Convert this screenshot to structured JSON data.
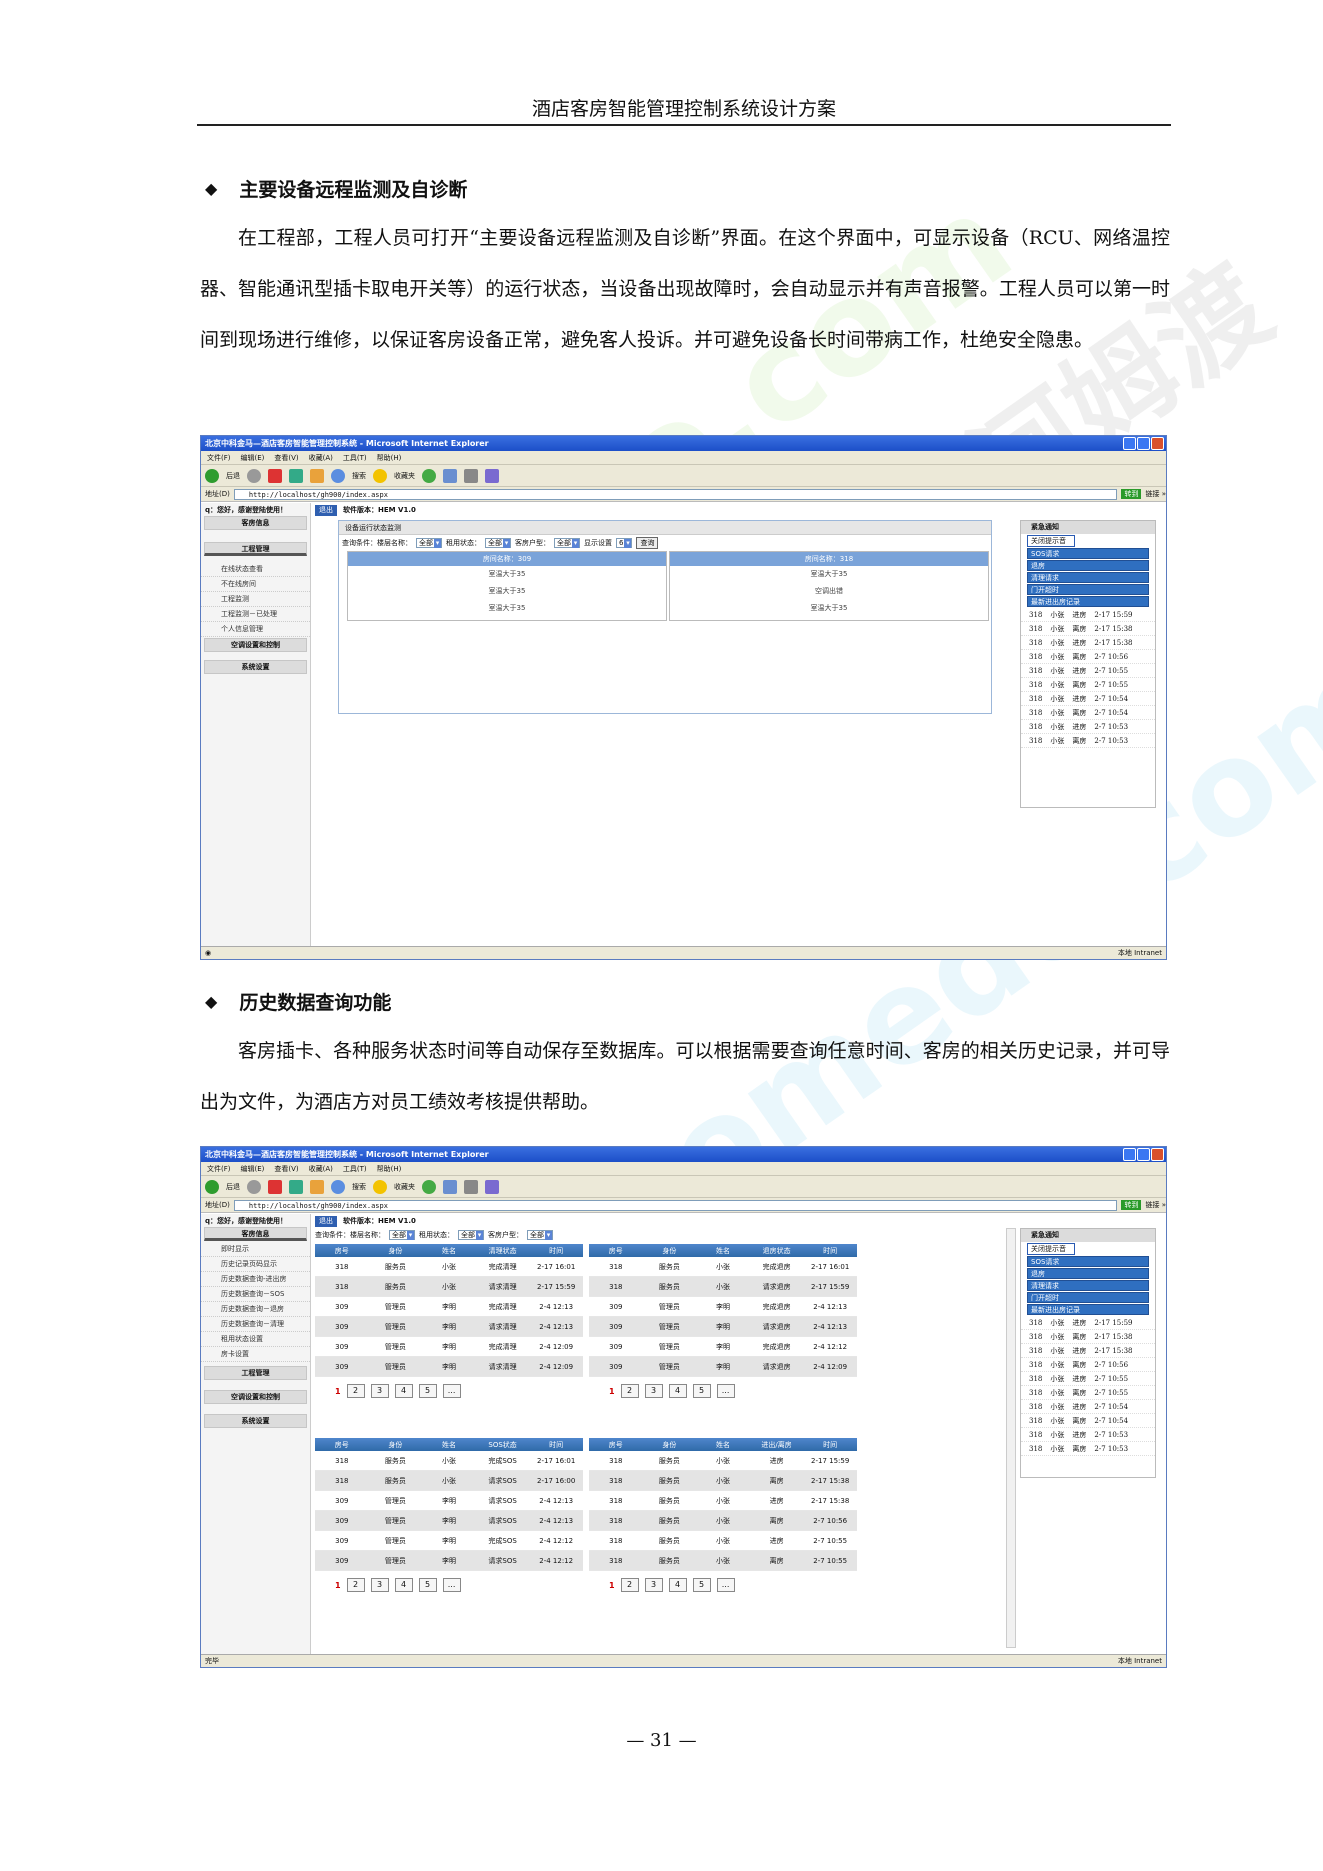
{
  "document": {
    "header": "酒店客房智能管理控制系统设计方案",
    "page_number": "— 31 —",
    "watermark": "homedo.com 河姆渡"
  },
  "section1": {
    "bullet": "◆",
    "title": "主要设备远程监测及自诊断",
    "paragraph": "在工程部，工程人员可打开“主要设备远程监测及自诊断”界面。在这个界面中，可显示设备（RCU、网络温控器、智能通讯型插卡取电开关等）的运行状态，当设备出现故障时，会自动显示并有声音报警。工程人员可以第一时间到现场进行维修，以保证客房设备正常，避免客人投诉。并可避免设备长时间带病工作，杜绝安全隐患。"
  },
  "section2": {
    "bullet": "◆",
    "title": "历史数据查询功能",
    "paragraph": "客房插卡、各种服务状态时间等自动保存至数据库。可以根据需要查询任意时间、客房的相关历史记录，并可导出为文件，为酒店方对员工绩效考核提供帮助。"
  },
  "browser": {
    "title": "北京中科金马—酒店客房智能管理控制系统 - Microsoft Internet Explorer",
    "menu": [
      "文件(F)",
      "编辑(E)",
      "查看(V)",
      "收藏(A)",
      "工具(T)",
      "帮助(H)"
    ],
    "toolbar": [
      "后退",
      "搜索",
      "收藏夹"
    ],
    "address_label": "地址(D)",
    "address": "http://localhost/gh900/index.aspx",
    "go": "转到",
    "links": "链接 »",
    "status_intranet": "本地 Intranet",
    "status_done": "完毕"
  },
  "app": {
    "greeting": "q：您好，感谢登陆使用！",
    "logout": "退出",
    "version": "软件版本：HEM V1.0",
    "customer_info": "客房信息",
    "engineering": "工程管理",
    "ac_control": "空调设置和控制",
    "system": "系统设置"
  },
  "screen1": {
    "nav_items": [
      "在线状态查看",
      "不在线房间",
      "工程监测",
      "工程监测－已处理",
      "个人信息管理"
    ],
    "panel_title": "设备运行状态监测",
    "query": {
      "label": "查询条件：楼层名称：",
      "floor": "全部",
      "rent_label": "租用状态：",
      "rent": "全部",
      "type_label": "客房户型：",
      "type": "全部",
      "show_label": "显示设置",
      "show": "6",
      "search": "查询"
    },
    "rooms": [
      {
        "name": "房间名称：309",
        "lines": [
          "室温大于35",
          "室温大于35",
          "室温大于35"
        ]
      },
      {
        "name": "房间名称：318",
        "lines": [
          "室温大于35",
          "空调出错",
          "室温大于35"
        ]
      }
    ]
  },
  "screen2": {
    "nav_items": [
      "即时显示",
      "历史记录页码显示",
      "历史数据查询-进出房",
      "历史数据查询－SOS",
      "历史数据查询－退房",
      "历史数据查询－清理",
      "租用状态设置",
      "房卡设置"
    ],
    "query": {
      "label": "查询条件：楼层名称：",
      "floor": "全部",
      "rent_label": "租用状态：",
      "rent": "全部",
      "type_label": "客房户型：",
      "type": "全部"
    },
    "grids": [
      {
        "headers": [
          "房号",
          "身份",
          "姓名",
          "清理状态",
          "时间"
        ],
        "rows": [
          [
            "318",
            "服务员",
            "小张",
            "完成清理",
            "2-17 16:01"
          ],
          [
            "318",
            "服务员",
            "小张",
            "请求清理",
            "2-17 15:59"
          ],
          [
            "309",
            "管理员",
            "李明",
            "完成清理",
            "2-4 12:13"
          ],
          [
            "309",
            "管理员",
            "李明",
            "请求清理",
            "2-4 12:13"
          ],
          [
            "309",
            "管理员",
            "李明",
            "完成清理",
            "2-4 12:09"
          ],
          [
            "309",
            "管理员",
            "李明",
            "请求清理",
            "2-4 12:09"
          ]
        ]
      },
      {
        "headers": [
          "房号",
          "身份",
          "姓名",
          "退房状态",
          "时间"
        ],
        "rows": [
          [
            "318",
            "服务员",
            "小张",
            "完成退房",
            "2-17 16:01"
          ],
          [
            "318",
            "服务员",
            "小张",
            "请求退房",
            "2-17 15:59"
          ],
          [
            "309",
            "管理员",
            "李明",
            "完成退房",
            "2-4 12:13"
          ],
          [
            "309",
            "管理员",
            "李明",
            "请求退房",
            "2-4 12:13"
          ],
          [
            "309",
            "管理员",
            "李明",
            "完成退房",
            "2-4 12:12"
          ],
          [
            "309",
            "管理员",
            "李明",
            "请求退房",
            "2-4 12:09"
          ]
        ]
      },
      {
        "headers": [
          "房号",
          "身份",
          "姓名",
          "SOS状态",
          "时间"
        ],
        "rows": [
          [
            "318",
            "服务员",
            "小张",
            "完成SOS",
            "2-17 16:01"
          ],
          [
            "318",
            "服务员",
            "小张",
            "请求SOS",
            "2-17 16:00"
          ],
          [
            "309",
            "管理员",
            "李明",
            "请求SOS",
            "2-4 12:13"
          ],
          [
            "309",
            "管理员",
            "李明",
            "请求SOS",
            "2-4 12:13"
          ],
          [
            "309",
            "管理员",
            "李明",
            "完成SOS",
            "2-4 12:12"
          ],
          [
            "309",
            "管理员",
            "李明",
            "请求SOS",
            "2-4 12:12"
          ]
        ]
      },
      {
        "headers": [
          "房号",
          "身份",
          "姓名",
          "进出/离房",
          "时间"
        ],
        "rows": [
          [
            "318",
            "服务员",
            "小张",
            "进房",
            "2-17 15:59"
          ],
          [
            "318",
            "服务员",
            "小张",
            "离房",
            "2-17 15:38"
          ],
          [
            "318",
            "服务员",
            "小张",
            "进房",
            "2-17 15:38"
          ],
          [
            "318",
            "服务员",
            "小张",
            "离房",
            "2-7 10:56"
          ],
          [
            "318",
            "服务员",
            "小张",
            "进房",
            "2-7 10:55"
          ],
          [
            "318",
            "服务员",
            "小张",
            "离房",
            "2-7 10:55"
          ]
        ]
      }
    ],
    "pager": [
      "1",
      "2",
      "3",
      "4",
      "5",
      "..."
    ]
  },
  "notice": {
    "title": "紧急通知",
    "close": "关闭提示音",
    "categories1": [
      "SOS请求",
      "退房",
      "清理请求",
      "门开超时",
      "最新进出房记录"
    ],
    "categories2": [
      "SOS请求",
      "退房",
      "清理请求",
      "门开超时",
      "最新进出房记录"
    ],
    "rows1": [
      [
        "318",
        "小张",
        "进房",
        "2-17 15:59"
      ],
      [
        "318",
        "小张",
        "离房",
        "2-17 15:38"
      ],
      [
        "318",
        "小张",
        "进房",
        "2-17 15:38"
      ],
      [
        "318",
        "小张",
        "离房",
        "2-7 10:56"
      ],
      [
        "318",
        "小张",
        "进房",
        "2-7 10:55"
      ],
      [
        "318",
        "小张",
        "离房",
        "2-7 10:55"
      ],
      [
        "318",
        "小张",
        "进房",
        "2-7 10:54"
      ],
      [
        "318",
        "小张",
        "离房",
        "2-7 10:54"
      ],
      [
        "318",
        "小张",
        "进房",
        "2-7 10:53"
      ],
      [
        "318",
        "小张",
        "离房",
        "2-7 10:53"
      ]
    ],
    "rows2": [
      [
        "318",
        "小张",
        "进房",
        "2-17 15:59"
      ],
      [
        "318",
        "小张",
        "离房",
        "2-17 15:38"
      ],
      [
        "318",
        "小张",
        "进房",
        "2-17 15:38"
      ],
      [
        "318",
        "小张",
        "离房",
        "2-7 10:56"
      ],
      [
        "318",
        "小张",
        "进房",
        "2-7 10:55"
      ],
      [
        "318",
        "小张",
        "离房",
        "2-7 10:55"
      ],
      [
        "318",
        "小张",
        "进房",
        "2-7 10:54"
      ],
      [
        "318",
        "小张",
        "离房",
        "2-7 10:54"
      ],
      [
        "318",
        "小张",
        "进房",
        "2-7 10:53"
      ],
      [
        "318",
        "小张",
        "离房",
        "2-7 10:53"
      ]
    ]
  },
  "colors": {
    "accent": "#2f6fc0",
    "titlebar": "#1c4fc8"
  }
}
